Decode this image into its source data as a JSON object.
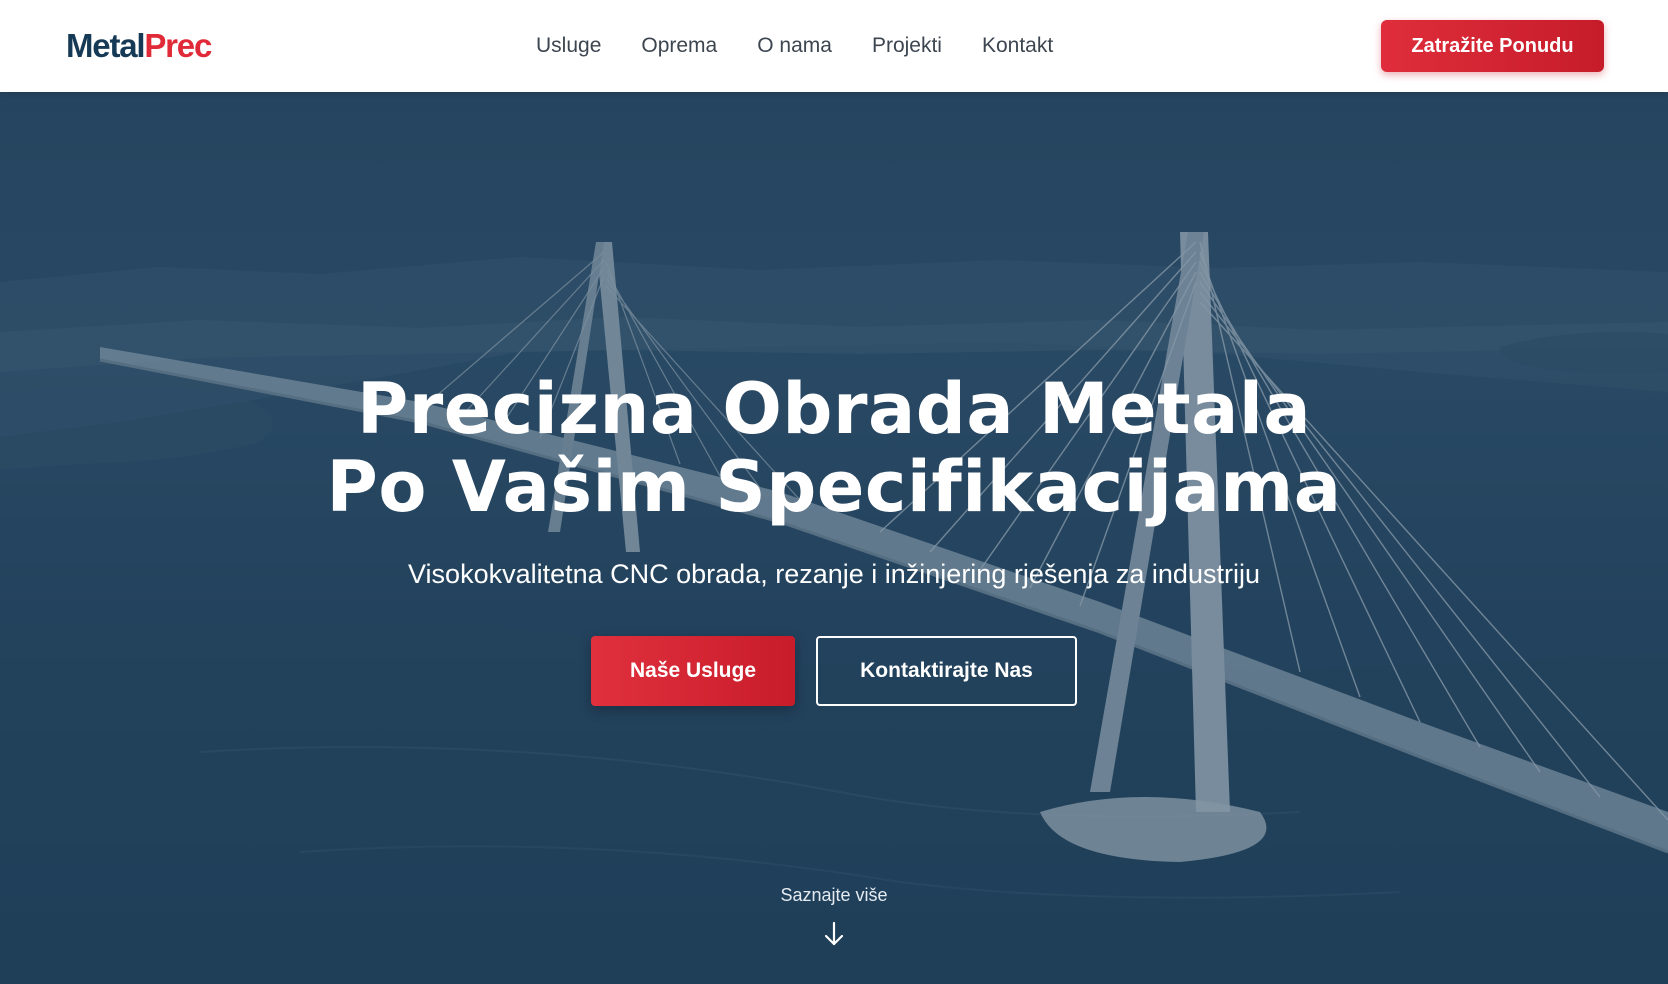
{
  "brand": {
    "part1": "Metal",
    "part2": "Prec"
  },
  "nav": {
    "items": [
      "Usluge",
      "Oprema",
      "O nama",
      "Projekti",
      "Kontakt"
    ]
  },
  "header": {
    "cta_label": "Zatražite Ponudu"
  },
  "hero": {
    "title_line1": "Precizna Obrada Metala",
    "title_line2": "Po Vašim Specifikacijama",
    "subtitle": "Visokokvalitetna CNC obrada, rezanje i inžinjering rješenja za industriju",
    "primary_button": "Naše Usluge",
    "secondary_button": "Kontaktirajte Nas",
    "scroll_label": "Saznajte više",
    "background_image": "cable-stayed-bridge-over-river",
    "scroll_icon": "arrow-down-icon"
  },
  "colors": {
    "brand_dark": "#163a55",
    "brand_red": "#e02a38",
    "hero_overlay": "#1e3d5a",
    "nav_text": "#3d4650"
  }
}
